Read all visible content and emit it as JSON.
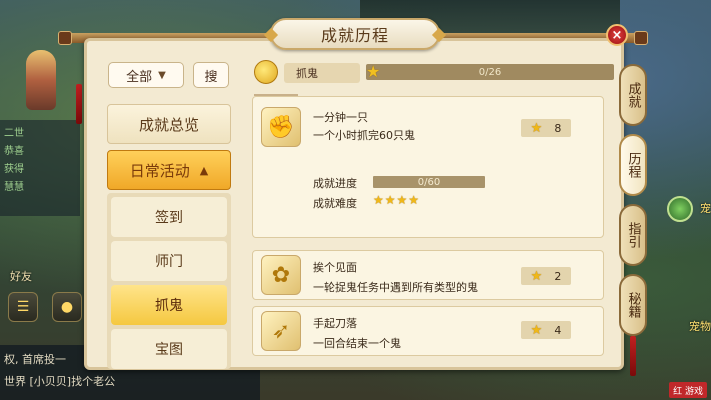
{
  "window": {
    "title": "成就历程",
    "close_label": "×"
  },
  "filter": {
    "selected": "全部",
    "search_label": "搜"
  },
  "categories": [
    {
      "label": "成就总览",
      "active": false,
      "expanded": false
    },
    {
      "label": "日常活动",
      "active": true,
      "expanded": true
    }
  ],
  "subcategories": [
    {
      "label": "签到",
      "active": false
    },
    {
      "label": "师门",
      "active": false
    },
    {
      "label": "抓鬼",
      "active": true
    },
    {
      "label": "宝图",
      "active": false
    }
  ],
  "category_summary": {
    "label": "抓鬼",
    "progress": "0/26",
    "progress_fraction": 0.0
  },
  "achievements": [
    {
      "title": "一分钟一只",
      "desc": "一个小时抓完60只鬼",
      "points": "8",
      "icon": "golden-gauntlet-icon",
      "expanded": true,
      "progress_label": "成就进度",
      "progress": "0/60",
      "progress_fraction": 0.0,
      "difficulty_label": "成就难度",
      "difficulty": 4
    },
    {
      "title": "挨个见面",
      "desc": "一轮捉鬼任务中遇到所有类型的鬼",
      "points": "2",
      "icon": "golden-flower-icon",
      "expanded": false
    },
    {
      "title": "手起刀落",
      "desc": "一回合结束一个鬼",
      "points": "4",
      "icon": "golden-scroll-icon",
      "expanded": false
    }
  ],
  "tabs": [
    {
      "label": "成就",
      "active": false
    },
    {
      "label": "历程",
      "active": true
    },
    {
      "label": "指引",
      "active": false
    },
    {
      "label": "秘籍",
      "active": false
    }
  ],
  "background": {
    "chat_lines": [
      "二世",
      "恭喜",
      "获得",
      "慧慧"
    ],
    "friends_label": "好友",
    "bottom_chat_lines": [
      "权, 首席投一",
      "世界 [小贝贝]找个老公"
    ],
    "right_labels": [
      "宠",
      "宠物"
    ],
    "watermark": "红 游戏"
  },
  "colors": {
    "panel": "#f3ead2",
    "active_category": "#f0a828",
    "active_sub": "#f5c840",
    "star": "#f0b818",
    "close": "#c02020"
  }
}
